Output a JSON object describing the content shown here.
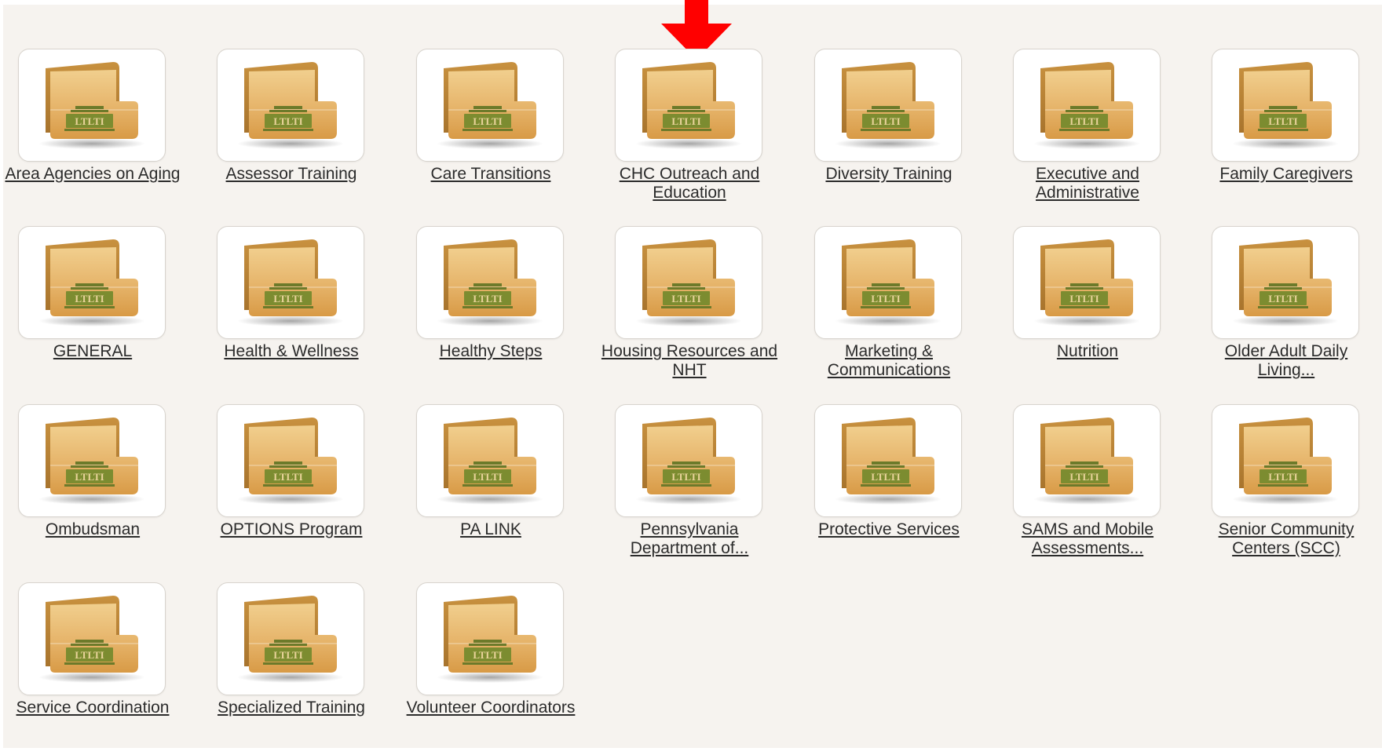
{
  "marker": {
    "color": "#ff0000",
    "name": "red-arrow-down"
  },
  "folder_icon": {
    "badge_text": "LTLTI"
  },
  "folders": [
    {
      "label": "Area Agencies on Aging"
    },
    {
      "label": "Assessor Training"
    },
    {
      "label": "Care Transitions"
    },
    {
      "label": "CHC Outreach and Education"
    },
    {
      "label": "Diversity Training"
    },
    {
      "label": "Executive and Administrative"
    },
    {
      "label": "Family Caregivers"
    },
    {
      "label": "GENERAL"
    },
    {
      "label": "Health & Wellness"
    },
    {
      "label": "Healthy Steps"
    },
    {
      "label": "Housing Resources and NHT"
    },
    {
      "label": "Marketing & Communications"
    },
    {
      "label": "Nutrition"
    },
    {
      "label": "Older Adult Daily Living..."
    },
    {
      "label": "Ombudsman"
    },
    {
      "label": "OPTIONS Program"
    },
    {
      "label": "PA LINK"
    },
    {
      "label": "Pennsylvania Department of..."
    },
    {
      "label": "Protective Services"
    },
    {
      "label": "SAMS and Mobile Assessments..."
    },
    {
      "label": "Senior Community Centers (SCC)"
    },
    {
      "label": "Service Coordination"
    },
    {
      "label": "Specialized Training"
    },
    {
      "label": "Volunteer Coordinators"
    }
  ]
}
